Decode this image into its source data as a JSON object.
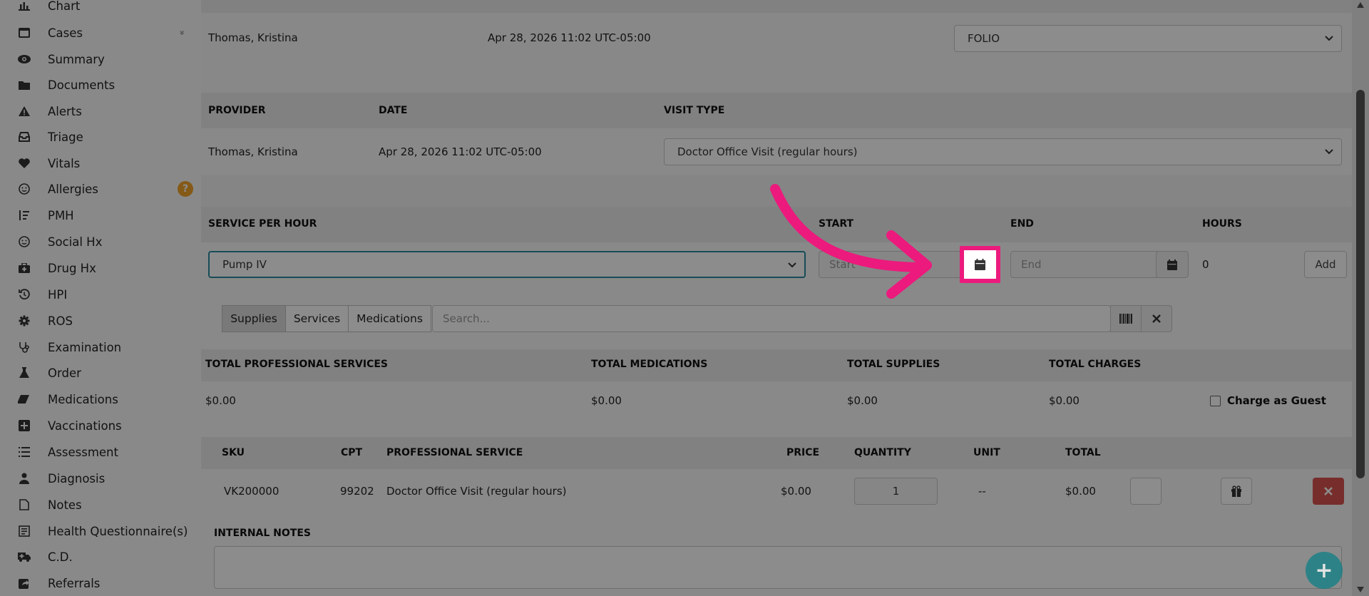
{
  "sidebar": {
    "items": [
      {
        "label": "Chart",
        "icon": "bar-chart-icon"
      },
      {
        "label": "Cases",
        "icon": "cases-icon"
      },
      {
        "label": "Summary",
        "icon": "eye-icon"
      },
      {
        "label": "Documents",
        "icon": "folder-icon"
      },
      {
        "label": "Alerts",
        "icon": "warning-icon"
      },
      {
        "label": "Triage",
        "icon": "inbox-icon"
      },
      {
        "label": "Vitals",
        "icon": "heart-icon"
      },
      {
        "label": "Allergies",
        "icon": "smile-icon",
        "badge": "?"
      },
      {
        "label": "PMH",
        "icon": "sort-list-icon"
      },
      {
        "label": "Social Hx",
        "icon": "smile-icon"
      },
      {
        "label": "Drug Hx",
        "icon": "medkit-icon"
      },
      {
        "label": "HPI",
        "icon": "history-icon"
      },
      {
        "label": "ROS",
        "icon": "gear-icon"
      },
      {
        "label": "Examination",
        "icon": "stethoscope-icon"
      },
      {
        "label": "Order",
        "icon": "flask-icon"
      },
      {
        "label": "Medications",
        "icon": "pill-icon"
      },
      {
        "label": "Vaccinations",
        "icon": "plus-square-icon"
      },
      {
        "label": "Assessment",
        "icon": "list-icon"
      },
      {
        "label": "Diagnosis",
        "icon": "user-md-icon"
      },
      {
        "label": "Notes",
        "icon": "file-icon"
      },
      {
        "label": "Health Questionnaire(s)",
        "icon": "form-icon"
      },
      {
        "label": "C.D.",
        "icon": "ambulance-icon"
      },
      {
        "label": "Referrals",
        "icon": "share-icon"
      }
    ],
    "cases_chevron": "»"
  },
  "top": {
    "created_by_value": "Thomas, Kristina",
    "created_date_value": "Apr 28, 2026 11:02 UTC-05:00",
    "supplement_type_value": "FOLIO"
  },
  "visit": {
    "provider_header": "PROVIDER",
    "date_header": "DATE",
    "visit_type_header": "VISIT TYPE",
    "provider_value": "Thomas, Kristina",
    "date_value": "Apr 28, 2026 11:02 UTC-05:00",
    "visit_type_value": "Doctor Office Visit (regular hours)"
  },
  "service": {
    "service_header": "SERVICE PER HOUR",
    "start_header": "START",
    "end_header": "END",
    "hours_header": "HOURS",
    "service_value": "Pump IV",
    "start_placeholder": "Start",
    "end_placeholder": "End",
    "hours_value": "0",
    "add_label": "Add"
  },
  "tabs": {
    "supplies": "Supplies",
    "services": "Services",
    "medications": "Medications",
    "search_placeholder": "Search..."
  },
  "totals": {
    "professional_header": "TOTAL PROFESSIONAL SERVICES",
    "medications_header": "TOTAL MEDICATIONS",
    "supplies_header": "TOTAL SUPPLIES",
    "charges_header": "TOTAL CHARGES",
    "professional_value": "$0.00",
    "medications_value": "$0.00",
    "supplies_value": "$0.00",
    "charges_value": "$0.00",
    "charge_as_guest": "Charge as Guest"
  },
  "table": {
    "headers": {
      "sku": "SKU",
      "cpt": "CPT",
      "service": "PROFESSIONAL SERVICE",
      "price": "PRICE",
      "quantity": "QUANTITY",
      "unit": "UNIT",
      "total": "TOTAL"
    },
    "row": {
      "sku": "VK200000",
      "cpt": "99202",
      "service": "Doctor Office Visit (regular hours)",
      "price": "$0.00",
      "quantity": "1",
      "unit": "--",
      "total": "$0.00"
    }
  },
  "notes": {
    "header": "INTERNAL NOTES"
  },
  "colors": {
    "highlight": "#ec1a7d",
    "fab": "#0e7f86",
    "delete": "#d9534f",
    "badge": "#f2a52a"
  }
}
